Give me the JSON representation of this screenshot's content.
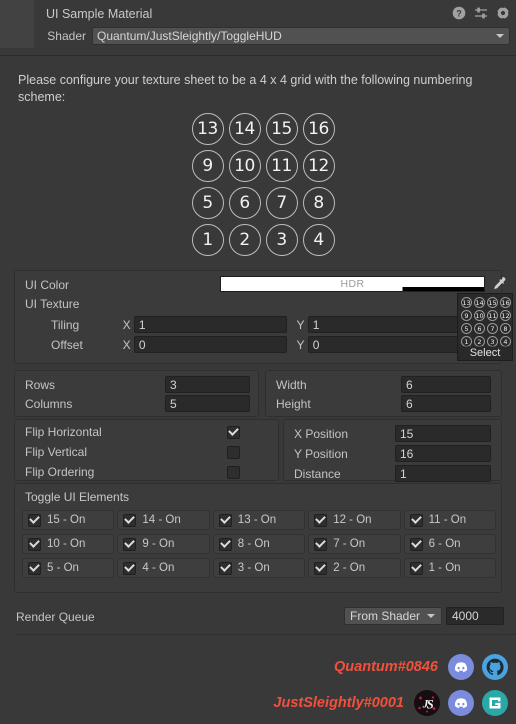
{
  "header": {
    "title": "UI Sample Material",
    "icons": [
      {
        "name": "help-icon",
        "glyph": "?"
      },
      {
        "name": "preset-icon",
        "glyph": "preset"
      },
      {
        "name": "gear-icon",
        "glyph": "gear"
      }
    ],
    "shader": {
      "label": "Shader",
      "value": "Quantum/JustSleightly/ToggleHUD",
      "caret": "chevron-down-icon"
    }
  },
  "description": "Please configure your texture sheet to be a 4 x 4 grid with the following numbering scheme:",
  "number_grid": {
    "rows": [
      [
        "13",
        "14",
        "15",
        "16"
      ],
      [
        "9",
        "10",
        "11",
        "12"
      ],
      [
        "5",
        "6",
        "7",
        "8"
      ],
      [
        "1",
        "2",
        "3",
        "4"
      ]
    ]
  },
  "texture_section": {
    "ui_color": {
      "label": "UI Color",
      "hdr_tag": "HDR",
      "swatch_color": "#ffffff",
      "alpha_fill_percent": 69,
      "eyedropper": "eyedropper-icon"
    },
    "ui_texture": {
      "label": "UI Texture",
      "preview_select_label": "Select",
      "preview_rows": [
        [
          "13",
          "14",
          "15",
          "16"
        ],
        [
          "9",
          "10",
          "11",
          "12"
        ],
        [
          "5",
          "6",
          "7",
          "8"
        ],
        [
          "1",
          "2",
          "3",
          "4"
        ]
      ]
    },
    "tiling": {
      "label": "Tiling",
      "x_axis": "X",
      "x_value": "1",
      "y_axis": "Y",
      "y_value": "1"
    },
    "offset": {
      "label": "Offset",
      "x_axis": "X",
      "x_value": "0",
      "y_axis": "Y",
      "y_value": "0"
    }
  },
  "grid_section": {
    "rows": {
      "label": "Rows",
      "value": "3"
    },
    "columns": {
      "label": "Columns",
      "value": "5"
    },
    "width": {
      "label": "Width",
      "value": "6"
    },
    "height": {
      "label": "Height",
      "value": "6"
    }
  },
  "flip_section": {
    "flip_horizontal": {
      "label": "Flip Horizontal",
      "checked": true
    },
    "flip_vertical": {
      "label": "Flip Vertical",
      "checked": false
    },
    "flip_ordering": {
      "label": "Flip Ordering",
      "checked": false
    },
    "x_position": {
      "label": "X Position",
      "value": "15"
    },
    "y_position": {
      "label": "Y Position",
      "value": "16"
    },
    "distance": {
      "label": "Distance",
      "value": "1"
    }
  },
  "toggles_section": {
    "title": "Toggle UI Elements",
    "items": [
      {
        "label": "15 - On",
        "checked": true
      },
      {
        "label": "14 - On",
        "checked": true
      },
      {
        "label": "13 - On",
        "checked": true
      },
      {
        "label": "12 - On",
        "checked": true
      },
      {
        "label": "11 - On",
        "checked": true
      },
      {
        "label": "10 - On",
        "checked": true
      },
      {
        "label": "9 - On",
        "checked": true
      },
      {
        "label": "8 - On",
        "checked": true
      },
      {
        "label": "7 - On",
        "checked": true
      },
      {
        "label": "6 - On",
        "checked": true
      },
      {
        "label": "5 - On",
        "checked": true
      },
      {
        "label": "4 - On",
        "checked": true
      },
      {
        "label": "3 - On",
        "checked": true
      },
      {
        "label": "2 - On",
        "checked": true
      },
      {
        "label": "1 - On",
        "checked": true
      }
    ]
  },
  "render_queue": {
    "label": "Render Queue",
    "mode": "From Shader",
    "value": "4000"
  },
  "credits": {
    "accent_color": "#f2503c",
    "rows": [
      {
        "name": "Quantum#0846",
        "icons": [
          {
            "name": "discord-icon",
            "color": "#7b8cdd"
          },
          {
            "name": "github-icon",
            "color": "#4aa3df"
          }
        ]
      },
      {
        "name": "JustSleightly#0001",
        "icons": [
          {
            "name": "justsleightly-logo-icon",
            "color": "#1a1014"
          },
          {
            "name": "discord-icon",
            "color": "#7b8cdd"
          },
          {
            "name": "gumroad-icon",
            "color": "#2aa8a8"
          }
        ]
      }
    ]
  }
}
